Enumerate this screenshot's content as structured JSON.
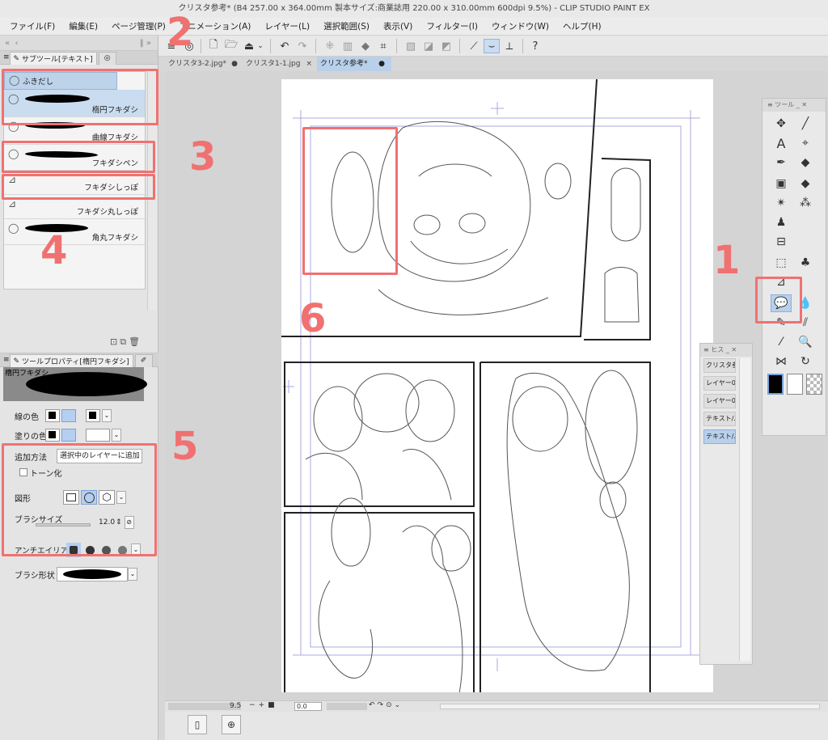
{
  "window": {
    "title": "クリスタ参考* (B4 257.00 x 364.00mm 製本サイズ:商業誌用 220.00 x 310.00mm 600dpi 9.5%) - CLIP STUDIO PAINT EX"
  },
  "menu": {
    "items": [
      "ファイル(F)",
      "編集(E)",
      "ページ管理(P)",
      "アニメーション(A)",
      "レイヤー(L)",
      "選択範囲(S)",
      "表示(V)",
      "フィルター(I)",
      "ウィンドウ(W)",
      "ヘルプ(H)"
    ]
  },
  "document_tabs": [
    {
      "label": "クリスタ3-2.jpg*",
      "active": false
    },
    {
      "label": "クリスタ1-1.jpg",
      "active": false
    },
    {
      "label": "クリスタ参考*",
      "active": true
    }
  ],
  "subtool_panel": {
    "tab_label": "サブツール[テキスト]",
    "group_label": "ふきだし",
    "items": [
      {
        "label": "楕円フキダシ",
        "selected": true
      },
      {
        "label": "曲線フキダシ",
        "selected": false
      },
      {
        "label": "フキダシペン",
        "selected": false
      },
      {
        "label": "フキダシしっぽ",
        "selected": false
      },
      {
        "label": "フキダシ丸しっぽ",
        "selected": false
      },
      {
        "label": "角丸フキダシ",
        "selected": false
      }
    ]
  },
  "tool_property": {
    "tab_label": "ツールプロパティ[楕円フキダシ]",
    "header_name": "楕円フキダシ",
    "line_color_label": "線の色",
    "fill_color_label": "塗りの色",
    "add_method_label": "追加方法",
    "add_method_value": "選択中のレイヤーに追加",
    "tone_label": "トーン化",
    "shape_label": "図形",
    "brush_size_label": "ブラシサイズ",
    "brush_size_value": "12.0",
    "antialias_label": "アンチエイリアス",
    "brush_shape_label": "ブラシ形状"
  },
  "tool_palette": {
    "title": "ツール"
  },
  "layer_panel": {
    "title": "ヒス",
    "items": [
      {
        "label": "クリスタ参考",
        "active": false
      },
      {
        "label": "レイヤー0",
        "active": false
      },
      {
        "label": "レイヤー0",
        "active": false
      },
      {
        "label": "テキスト/ふ",
        "active": false
      },
      {
        "label": "テキスト/ふ",
        "active": true
      }
    ]
  },
  "statusbar": {
    "zoom": "9.5",
    "rotation": "0.0"
  },
  "annotations": [
    "1",
    "2",
    "3",
    "4",
    "5",
    "6"
  ],
  "colors": {
    "highlight": "#f07171",
    "selection": "#b9d0ea"
  }
}
